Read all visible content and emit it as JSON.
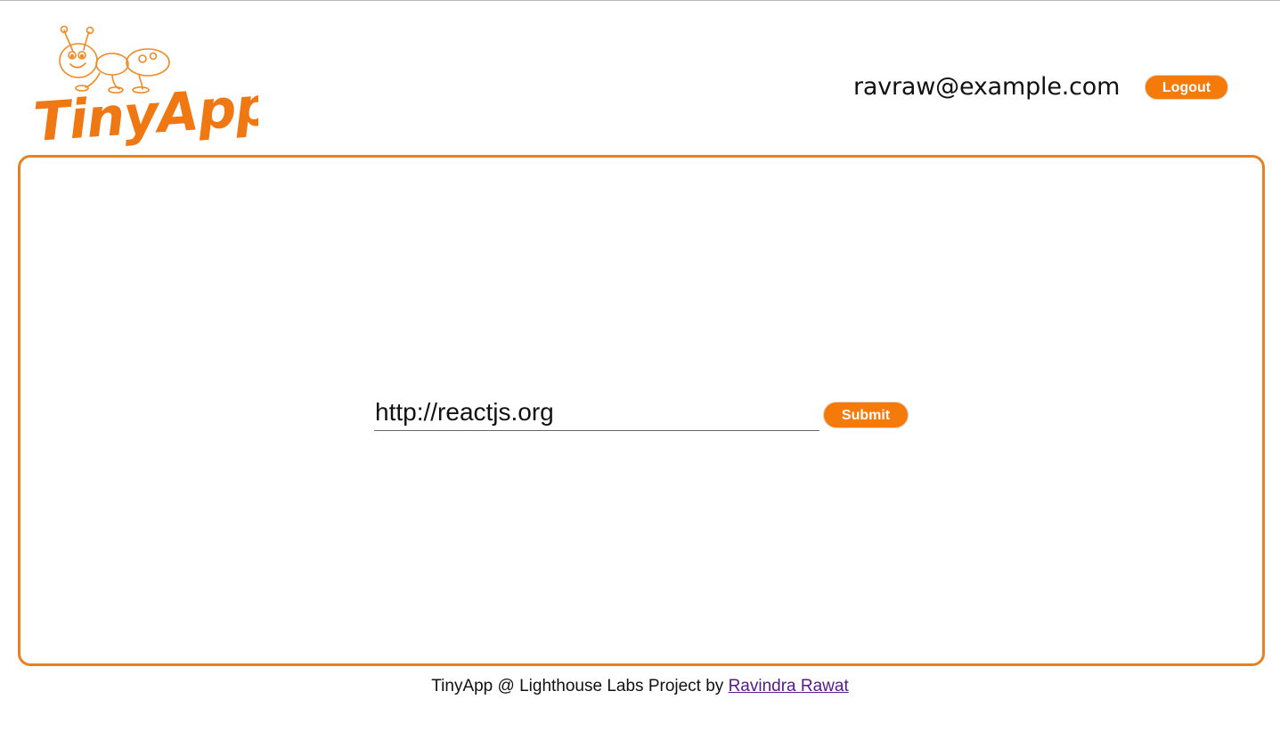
{
  "header": {
    "logo_text": "TinyApp",
    "user_email": "ravraw@example.com",
    "logout_label": "Logout"
  },
  "form": {
    "url_value": "http://reactjs.org",
    "submit_label": "Submit"
  },
  "footer": {
    "text": "TinyApp @ Lighthouse Labs Project by ",
    "author_link": "Ravindra Rawat"
  },
  "colors": {
    "accent": "#f47a0a",
    "panel_border": "#e8811f",
    "link": "#551a8b"
  }
}
